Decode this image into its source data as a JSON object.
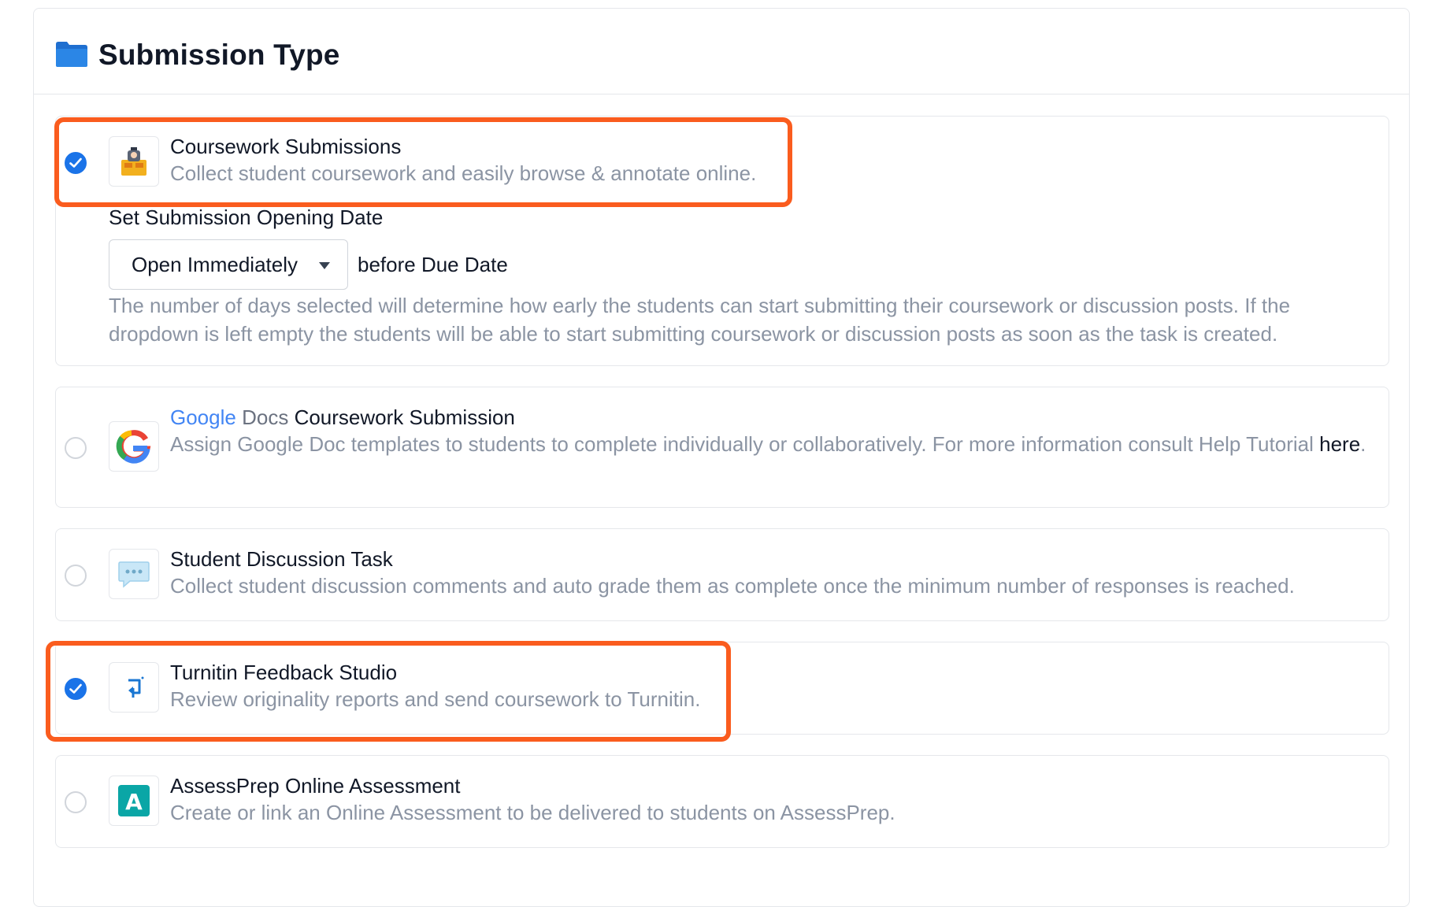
{
  "section": {
    "title": "Submission Type",
    "icon": "folder-icon"
  },
  "options": [
    {
      "title": "Coursework Submissions",
      "description": "Collect student coursework and easily browse & annotate online.",
      "checked": true,
      "icon": "coursework-icon"
    },
    {
      "brand_google": "Google",
      "brand_docs": "Docs",
      "title": "Coursework Submission",
      "description": "Assign Google Doc templates to students to complete individually or collaboratively. For more information consult Help Tutorial",
      "link_text": "here",
      "link_suffix": ".",
      "checked": false,
      "icon": "google-docs-icon"
    },
    {
      "title": "Student Discussion Task",
      "description": "Collect student discussion comments and auto grade them as complete once the minimum number of responses is reached.",
      "checked": false,
      "icon": "chat-bubble-icon"
    },
    {
      "title": "Turnitin Feedback Studio",
      "description": "Review originality reports and send coursework to Turnitin.",
      "checked": true,
      "icon": "turnitin-icon"
    },
    {
      "title": "AssessPrep Online Assessment",
      "description": "Create or link an Online Assessment to be delivered to students on AssessPrep.",
      "checked": false,
      "icon": "assessprep-icon"
    }
  ],
  "opening_date": {
    "label": "Set Submission Opening Date",
    "selected": "Open Immediately",
    "suffix": "before Due Date",
    "help": "The number of days selected will determine how early the students can start submitting their coursework or discussion posts. If the dropdown is left empty the students will be able to start submitting coursework or discussion posts as soon as the task is created."
  },
  "colors": {
    "accent": "#1a73e8",
    "highlight": "#fa5c1e",
    "muted_text": "#8b94a3",
    "border": "#e5e7eb"
  }
}
